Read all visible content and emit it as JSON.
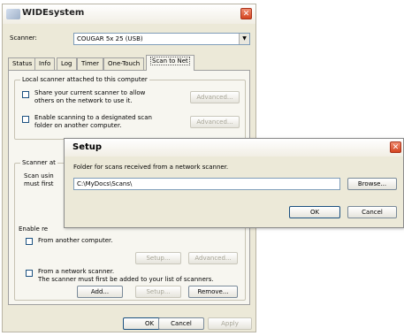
{
  "window": {
    "title": "WIDEsystem",
    "scanner_label": "Scanner:",
    "scanner_value": "COUGAR 5x 25 (USB)",
    "close_glyph": "✕",
    "dropdown_glyph": "▼"
  },
  "tabs": [
    "Status",
    "Info",
    "Log",
    "Timer",
    "One-Touch",
    "Scan to Net"
  ],
  "local_group": {
    "title": "Local scanner attached to this computer",
    "share_label_1": "Share your current scanner to allow",
    "share_label_2": "others on the network to use it.",
    "advanced_1": "Advanced...",
    "enable_label_1": "Enable scanning to a designated scan",
    "enable_label_2": "folder on another computer.",
    "advanced_2": "Advanced..."
  },
  "scanner_group": {
    "title": "Scanner at",
    "line1": "Scan usin",
    "line2": "must first",
    "enable_rec": "Enable re",
    "from_computer": "From another computer.",
    "setup_1": "Setup...",
    "advanced_3": "Advanced...",
    "from_scanner_1": "From a network scanner.",
    "from_scanner_2": "The scanner must first be added to your list of scanners.",
    "add": "Add...",
    "setup_2": "Setup...",
    "remove": "Remove..."
  },
  "footer": {
    "ok": "OK",
    "cancel": "Cancel",
    "apply": "Apply"
  },
  "dialog": {
    "title": "Setup",
    "prompt": "Folder for scans received from a network scanner.",
    "path_value": "C:\\MyDocs\\Scans\\",
    "browse": "Browse...",
    "ok": "OK",
    "cancel": "Cancel",
    "close_glyph": "✕"
  }
}
